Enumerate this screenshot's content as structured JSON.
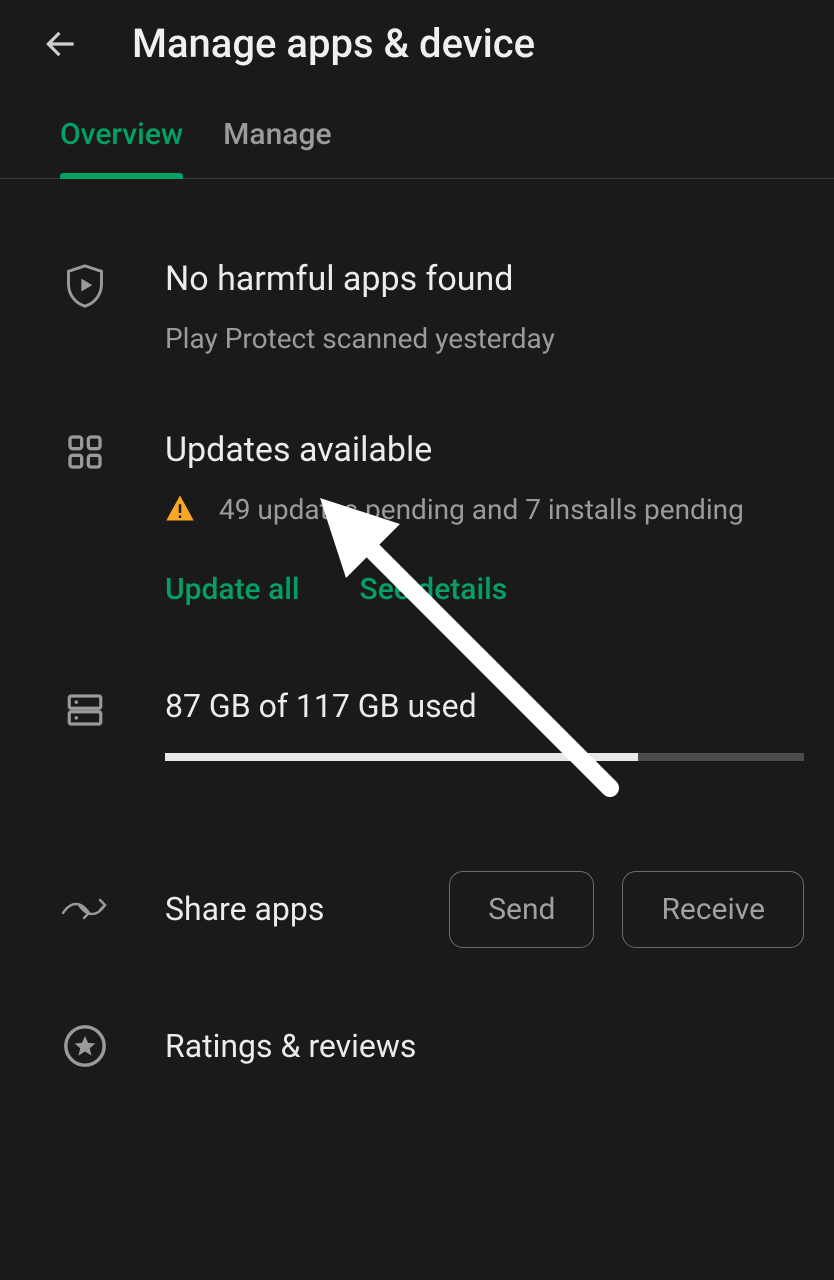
{
  "header": {
    "title": "Manage apps & device"
  },
  "tabs": {
    "items": [
      "Overview",
      "Manage"
    ],
    "active": 0
  },
  "protect": {
    "title": "No harmful apps found",
    "subtitle": "Play Protect scanned yesterday"
  },
  "updates": {
    "title": "Updates available",
    "subtitle": "49 updates pending and 7 installs pending",
    "update_all_label": "Update all",
    "see_details_label": "See details"
  },
  "storage": {
    "label": "87 GB of 117 GB used",
    "used_gb": 87,
    "total_gb": 117,
    "fill_percent": 74
  },
  "share": {
    "label": "Share apps",
    "send_label": "Send",
    "receive_label": "Receive"
  },
  "ratings": {
    "label": "Ratings & reviews"
  },
  "colors": {
    "accent": "#02a065",
    "warning": "#f9a825"
  }
}
